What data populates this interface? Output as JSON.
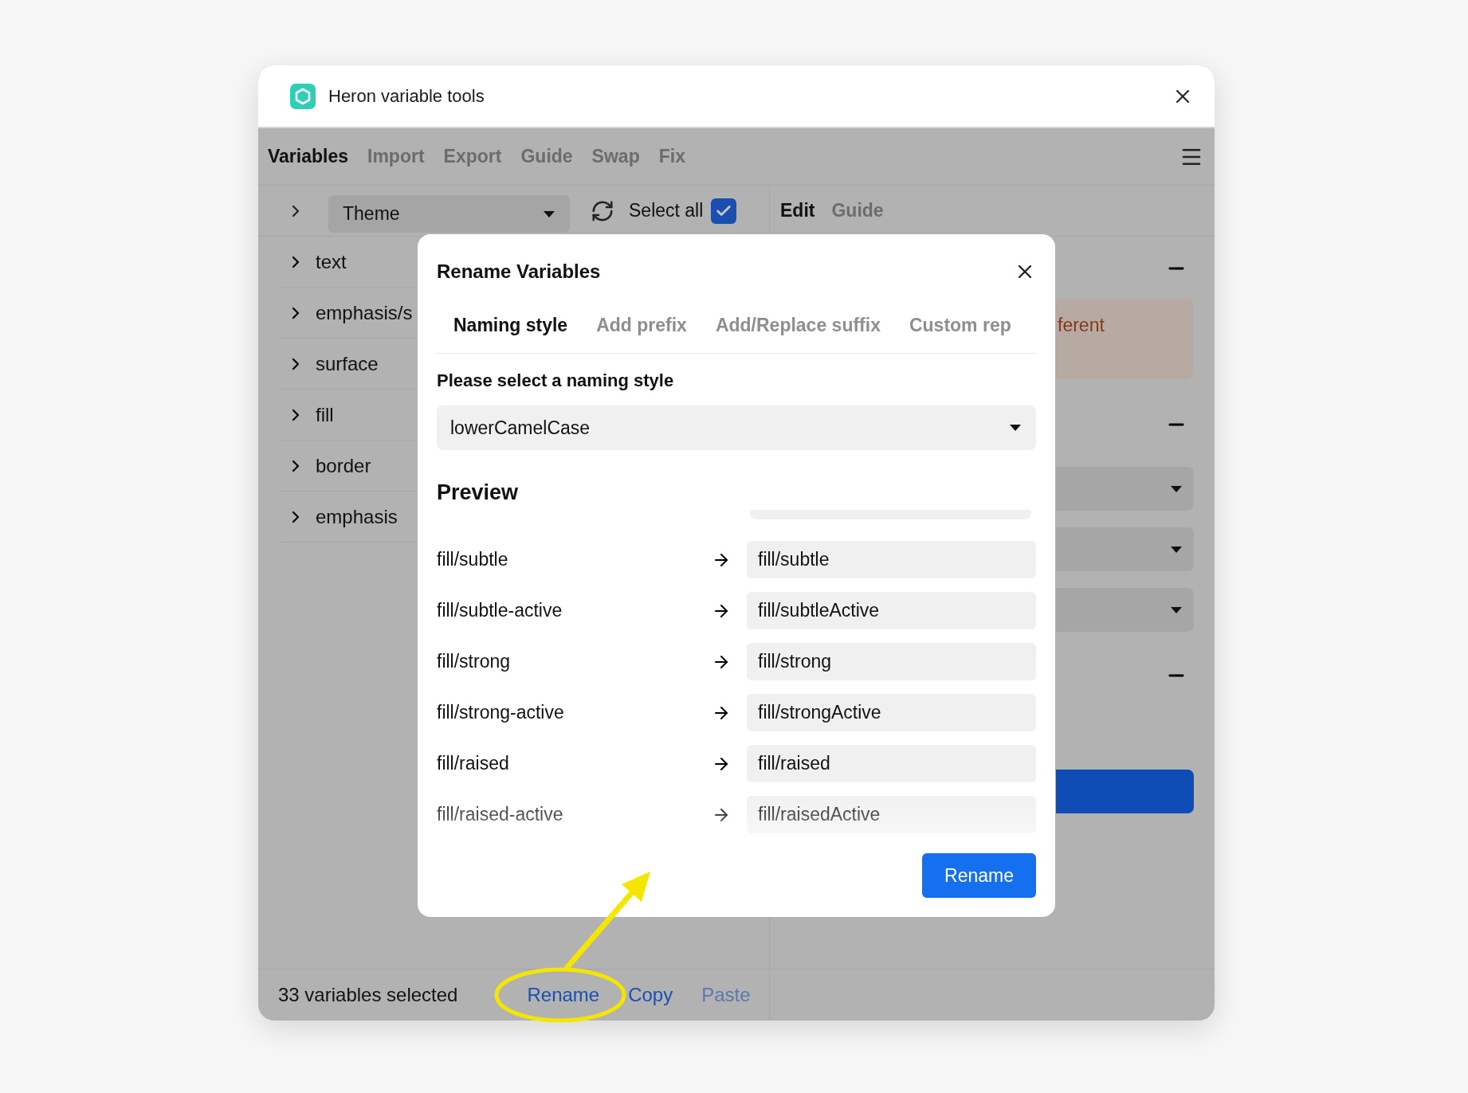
{
  "window": {
    "title": "Heron variable tools"
  },
  "nav": {
    "tabs": [
      {
        "label": "Variables",
        "selected": true
      },
      {
        "label": "Import",
        "selected": false
      },
      {
        "label": "Export",
        "selected": false
      },
      {
        "label": "Guide",
        "selected": false
      },
      {
        "label": "Swap",
        "selected": false
      },
      {
        "label": "Fix",
        "selected": false
      }
    ]
  },
  "toolbar": {
    "collection": "Theme",
    "select_all": {
      "label": "Select all",
      "checked": true
    }
  },
  "variable_groups": [
    {
      "name": "text",
      "expanded": false
    },
    {
      "name": "emphasis/s",
      "expanded": false
    },
    {
      "name": "surface",
      "expanded": false
    },
    {
      "name": "fill",
      "expanded": false
    },
    {
      "name": "border",
      "expanded": false
    },
    {
      "name": "emphasis",
      "expanded": false
    }
  ],
  "right_panel": {
    "tabs": [
      {
        "label": "Edit",
        "selected": true
      },
      {
        "label": "Guide",
        "selected": false
      }
    ],
    "notice": "ferent"
  },
  "status_bar": {
    "count": "33 variables selected",
    "actions": [
      {
        "label": "Rename",
        "disabled": false
      },
      {
        "label": "Copy",
        "disabled": false
      },
      {
        "label": "Paste",
        "disabled": true
      }
    ]
  },
  "dialog": {
    "title": "Rename Variables",
    "tabs": [
      {
        "label": "Naming style",
        "selected": true
      },
      {
        "label": "Add prefix",
        "selected": false
      },
      {
        "label": "Add/Replace suffix",
        "selected": false
      },
      {
        "label": "Custom rep",
        "selected": false
      }
    ],
    "style_label": "Please select a naming style",
    "style_value": "lowerCamelCase",
    "preview_title": "Preview",
    "preview_rows": [
      {
        "from": "fill/subtle",
        "to": "fill/subtle"
      },
      {
        "from": "fill/subtle-active",
        "to": "fill/subtleActive"
      },
      {
        "from": "fill/strong",
        "to": "fill/strong"
      },
      {
        "from": "fill/strong-active",
        "to": "fill/strongActive"
      },
      {
        "from": "fill/raised",
        "to": "fill/raised"
      },
      {
        "from": "fill/raised-active",
        "to": "fill/raisedActive"
      }
    ],
    "confirm": "Rename"
  }
}
